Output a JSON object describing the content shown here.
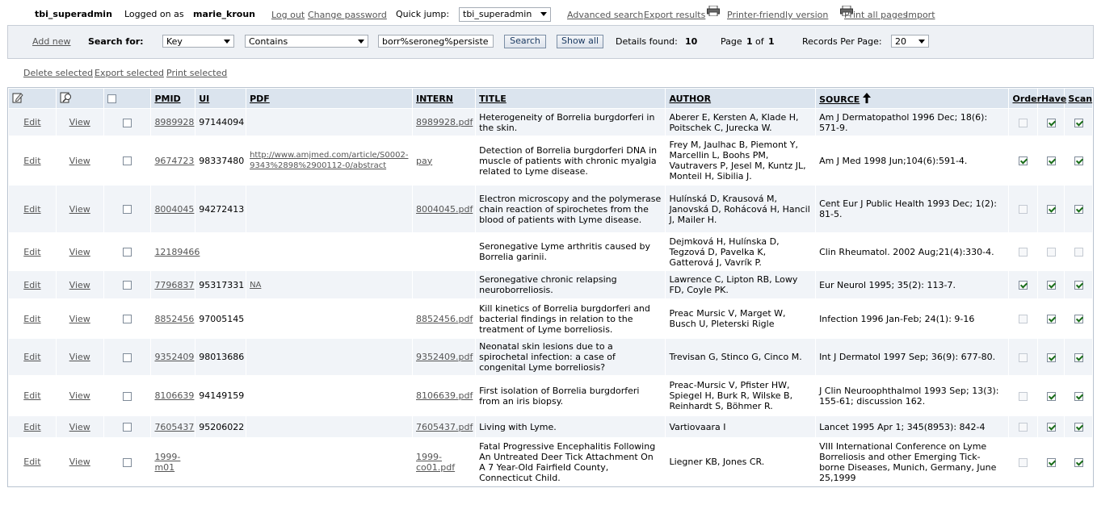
{
  "topbar": {
    "db_name": "tbi_superadmin",
    "logged_label": "Logged on as",
    "user": "marie_kroun",
    "logout": "Log out",
    "change_password": "Change password",
    "quick_jump_label": "Quick jump:",
    "quick_jump_value": "tbi_superadmin",
    "advanced_search": "Advanced search",
    "export_results": "Export results",
    "printer_friendly": "Printer-friendly version",
    "print_all": "Print all pages",
    "import": "Import"
  },
  "search": {
    "add_new": "Add new",
    "search_for_label": "Search for:",
    "field_value": "Key",
    "op_value": "Contains",
    "query_value": "borr%seroneg%persiste",
    "search_button": "Search",
    "show_all_button": "Show all",
    "details_found_label": "Details found:",
    "details_found_value": "10",
    "page_label": "Page",
    "page_current": "1",
    "page_of": "of",
    "page_total": "1",
    "records_per_page_label": "Records Per Page:",
    "records_per_page_value": "20"
  },
  "actions": {
    "delete_selected": "Delete selected",
    "export_selected": "Export selected",
    "print_selected": "Print selected"
  },
  "columns": {
    "pmid": "PMID",
    "ui": "UI",
    "pdf": "PDF",
    "intern": "INTERN",
    "title": "TITLE",
    "author": "AUTHOR",
    "source": "SOURCE",
    "order": "Order",
    "have": "Have",
    "scan": "Scan"
  },
  "rows": [
    {
      "edit": "Edit",
      "view": "View",
      "pmid": "8989928",
      "ui": "97144094",
      "pdf": "",
      "intern": "8989928.pdf",
      "title": "Heterogeneity of Borrelia burgdorferi in the skin.",
      "author": "Aberer E, Kersten A, Klade H, Poitschek C, Jurecka W.",
      "source": "Am J Dermatopathol 1996 Dec; 18(6): 571-9.",
      "order": false,
      "have": true,
      "scan": true
    },
    {
      "edit": "Edit",
      "view": "View",
      "pmid": "9674723",
      "ui": "98337480",
      "pdf": "http://www.amjmed.com/article/S0002-9343%2898%2900112-0/abstract",
      "intern": "pay",
      "title": "Detection of Borrelia burgdorferi DNA in muscle of patients with chronic myalgia related to Lyme disease.",
      "author": "Frey M, Jaulhac B, Piemont Y, Marcellin L, Boohs PM, Vautravers P, Jesel M, Kuntz JL, Monteil H, Sibilia J.",
      "source": "Am J Med 1998 Jun;104(6):591-4.",
      "order": true,
      "have": true,
      "scan": true
    },
    {
      "edit": "Edit",
      "view": "View",
      "pmid": "8004045",
      "ui": "94272413",
      "pdf": "",
      "intern": "8004045.pdf",
      "title": "Electron microscopy and the polymerase chain reaction of spirochetes from the blood of patients with Lyme disease.",
      "author": "Hulínská D, Krausová M, Janovská D, Rohácová H, Hancil J, Mailer H.",
      "source": "Cent Eur J Public Health 1993 Dec; 1(2): 81-5.",
      "order": false,
      "have": true,
      "scan": true
    },
    {
      "edit": "Edit",
      "view": "View",
      "pmid": "12189466",
      "ui": "",
      "pdf": "",
      "intern": "",
      "title": "Seronegative Lyme arthritis caused by Borrelia garinii.",
      "author": "Dejmková H, Hulínska D, Tegzová D, Pavelka K, Gatterová J, Vavrík P.",
      "source": "Clin Rheumatol. 2002 Aug;21(4):330-4.",
      "order": false,
      "have": false,
      "scan": false
    },
    {
      "edit": "Edit",
      "view": "View",
      "pmid": "7796837",
      "ui": "95317331",
      "pdf": "NA",
      "intern": "",
      "title": "Seronegative chronic relapsing neuroborreliosis.",
      "author": "Lawrence C, Lipton RB, Lowy FD, Coyle PK.",
      "source": "Eur Neurol 1995; 35(2): 113-7.",
      "order": true,
      "have": true,
      "scan": true
    },
    {
      "edit": "Edit",
      "view": "View",
      "pmid": "8852456",
      "ui": "97005145",
      "pdf": "",
      "intern": "8852456.pdf",
      "title": "Kill kinetics of Borrelia burgdorferi and bacterial findings in relation to the treatment of Lyme borreliosis.",
      "author": "Preac Mursic V, Marget W, Busch U, Pleterski Rigle",
      "source": "Infection 1996 Jan-Feb; 24(1): 9-16",
      "order": false,
      "have": true,
      "scan": true
    },
    {
      "edit": "Edit",
      "view": "View",
      "pmid": "9352409",
      "ui": "98013686",
      "pdf": "",
      "intern": "9352409.pdf",
      "title": "Neonatal skin lesions due to a spirochetal infection: a case of congenital Lyme borreliosis?",
      "author": "Trevisan G, Stinco G, Cinco M.",
      "source": "Int J Dermatol 1997 Sep; 36(9): 677-80.",
      "order": false,
      "have": true,
      "scan": true
    },
    {
      "edit": "Edit",
      "view": "View",
      "pmid": "8106639",
      "ui": "94149159",
      "pdf": "",
      "intern": "8106639.pdf",
      "title": "First isolation of Borrelia burgdorferi from an iris biopsy.",
      "author": "Preac-Mursic V, Pfister HW, Spiegel H, Burk R, Wilske B, Reinhardt S, Böhmer R.",
      "source": "J Clin Neuroophthalmol 1993 Sep; 13(3): 155-61; discussion 162.",
      "order": false,
      "have": true,
      "scan": true
    },
    {
      "edit": "Edit",
      "view": "View",
      "pmid": "7605437",
      "ui": "95206022",
      "pdf": "",
      "intern": "7605437.pdf",
      "title": "Living with Lyme.",
      "author": "Vartiovaara I",
      "source": "Lancet 1995 Apr 1; 345(8953): 842-4",
      "order": false,
      "have": true,
      "scan": true
    },
    {
      "edit": "Edit",
      "view": "View",
      "pmid": "1999-m01",
      "ui": "",
      "pdf": "",
      "intern": "1999-co01.pdf",
      "title": "Fatal Progressive Encephalitis Following An Untreated Deer Tick Attachment On A 7 Year-Old Fairfield County, Connecticut Child.",
      "author": "Liegner KB, Jones CR.",
      "source": "VIII International Conference on Lyme Borreliosis and other Emerging Tick-borne Diseases, Munich, Germany, June 25,1999",
      "order": false,
      "have": true,
      "scan": true
    }
  ]
}
